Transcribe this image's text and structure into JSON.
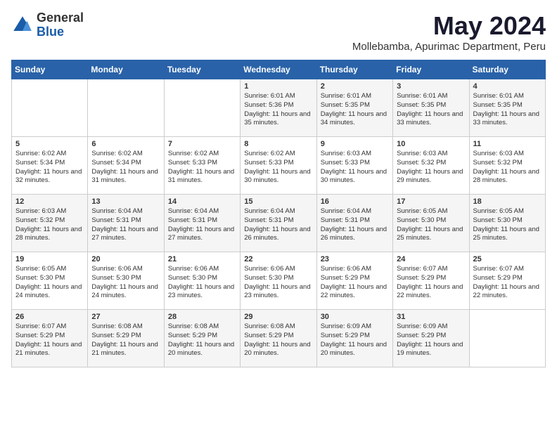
{
  "logo": {
    "general": "General",
    "blue": "Blue"
  },
  "title": {
    "month": "May 2024",
    "location": "Mollebamba, Apurimac Department, Peru"
  },
  "weekdays": [
    "Sunday",
    "Monday",
    "Tuesday",
    "Wednesday",
    "Thursday",
    "Friday",
    "Saturday"
  ],
  "weeks": [
    [
      {
        "day": "",
        "content": ""
      },
      {
        "day": "",
        "content": ""
      },
      {
        "day": "",
        "content": ""
      },
      {
        "day": "1",
        "content": "Sunrise: 6:01 AM\nSunset: 5:36 PM\nDaylight: 11 hours and 35 minutes."
      },
      {
        "day": "2",
        "content": "Sunrise: 6:01 AM\nSunset: 5:35 PM\nDaylight: 11 hours and 34 minutes."
      },
      {
        "day": "3",
        "content": "Sunrise: 6:01 AM\nSunset: 5:35 PM\nDaylight: 11 hours and 33 minutes."
      },
      {
        "day": "4",
        "content": "Sunrise: 6:01 AM\nSunset: 5:35 PM\nDaylight: 11 hours and 33 minutes."
      }
    ],
    [
      {
        "day": "5",
        "content": "Sunrise: 6:02 AM\nSunset: 5:34 PM\nDaylight: 11 hours and 32 minutes."
      },
      {
        "day": "6",
        "content": "Sunrise: 6:02 AM\nSunset: 5:34 PM\nDaylight: 11 hours and 31 minutes."
      },
      {
        "day": "7",
        "content": "Sunrise: 6:02 AM\nSunset: 5:33 PM\nDaylight: 11 hours and 31 minutes."
      },
      {
        "day": "8",
        "content": "Sunrise: 6:02 AM\nSunset: 5:33 PM\nDaylight: 11 hours and 30 minutes."
      },
      {
        "day": "9",
        "content": "Sunrise: 6:03 AM\nSunset: 5:33 PM\nDaylight: 11 hours and 30 minutes."
      },
      {
        "day": "10",
        "content": "Sunrise: 6:03 AM\nSunset: 5:32 PM\nDaylight: 11 hours and 29 minutes."
      },
      {
        "day": "11",
        "content": "Sunrise: 6:03 AM\nSunset: 5:32 PM\nDaylight: 11 hours and 28 minutes."
      }
    ],
    [
      {
        "day": "12",
        "content": "Sunrise: 6:03 AM\nSunset: 5:32 PM\nDaylight: 11 hours and 28 minutes."
      },
      {
        "day": "13",
        "content": "Sunrise: 6:04 AM\nSunset: 5:31 PM\nDaylight: 11 hours and 27 minutes."
      },
      {
        "day": "14",
        "content": "Sunrise: 6:04 AM\nSunset: 5:31 PM\nDaylight: 11 hours and 27 minutes."
      },
      {
        "day": "15",
        "content": "Sunrise: 6:04 AM\nSunset: 5:31 PM\nDaylight: 11 hours and 26 minutes."
      },
      {
        "day": "16",
        "content": "Sunrise: 6:04 AM\nSunset: 5:31 PM\nDaylight: 11 hours and 26 minutes."
      },
      {
        "day": "17",
        "content": "Sunrise: 6:05 AM\nSunset: 5:30 PM\nDaylight: 11 hours and 25 minutes."
      },
      {
        "day": "18",
        "content": "Sunrise: 6:05 AM\nSunset: 5:30 PM\nDaylight: 11 hours and 25 minutes."
      }
    ],
    [
      {
        "day": "19",
        "content": "Sunrise: 6:05 AM\nSunset: 5:30 PM\nDaylight: 11 hours and 24 minutes."
      },
      {
        "day": "20",
        "content": "Sunrise: 6:06 AM\nSunset: 5:30 PM\nDaylight: 11 hours and 24 minutes."
      },
      {
        "day": "21",
        "content": "Sunrise: 6:06 AM\nSunset: 5:30 PM\nDaylight: 11 hours and 23 minutes."
      },
      {
        "day": "22",
        "content": "Sunrise: 6:06 AM\nSunset: 5:30 PM\nDaylight: 11 hours and 23 minutes."
      },
      {
        "day": "23",
        "content": "Sunrise: 6:06 AM\nSunset: 5:29 PM\nDaylight: 11 hours and 22 minutes."
      },
      {
        "day": "24",
        "content": "Sunrise: 6:07 AM\nSunset: 5:29 PM\nDaylight: 11 hours and 22 minutes."
      },
      {
        "day": "25",
        "content": "Sunrise: 6:07 AM\nSunset: 5:29 PM\nDaylight: 11 hours and 22 minutes."
      }
    ],
    [
      {
        "day": "26",
        "content": "Sunrise: 6:07 AM\nSunset: 5:29 PM\nDaylight: 11 hours and 21 minutes."
      },
      {
        "day": "27",
        "content": "Sunrise: 6:08 AM\nSunset: 5:29 PM\nDaylight: 11 hours and 21 minutes."
      },
      {
        "day": "28",
        "content": "Sunrise: 6:08 AM\nSunset: 5:29 PM\nDaylight: 11 hours and 20 minutes."
      },
      {
        "day": "29",
        "content": "Sunrise: 6:08 AM\nSunset: 5:29 PM\nDaylight: 11 hours and 20 minutes."
      },
      {
        "day": "30",
        "content": "Sunrise: 6:09 AM\nSunset: 5:29 PM\nDaylight: 11 hours and 20 minutes."
      },
      {
        "day": "31",
        "content": "Sunrise: 6:09 AM\nSunset: 5:29 PM\nDaylight: 11 hours and 19 minutes."
      },
      {
        "day": "",
        "content": ""
      }
    ]
  ]
}
